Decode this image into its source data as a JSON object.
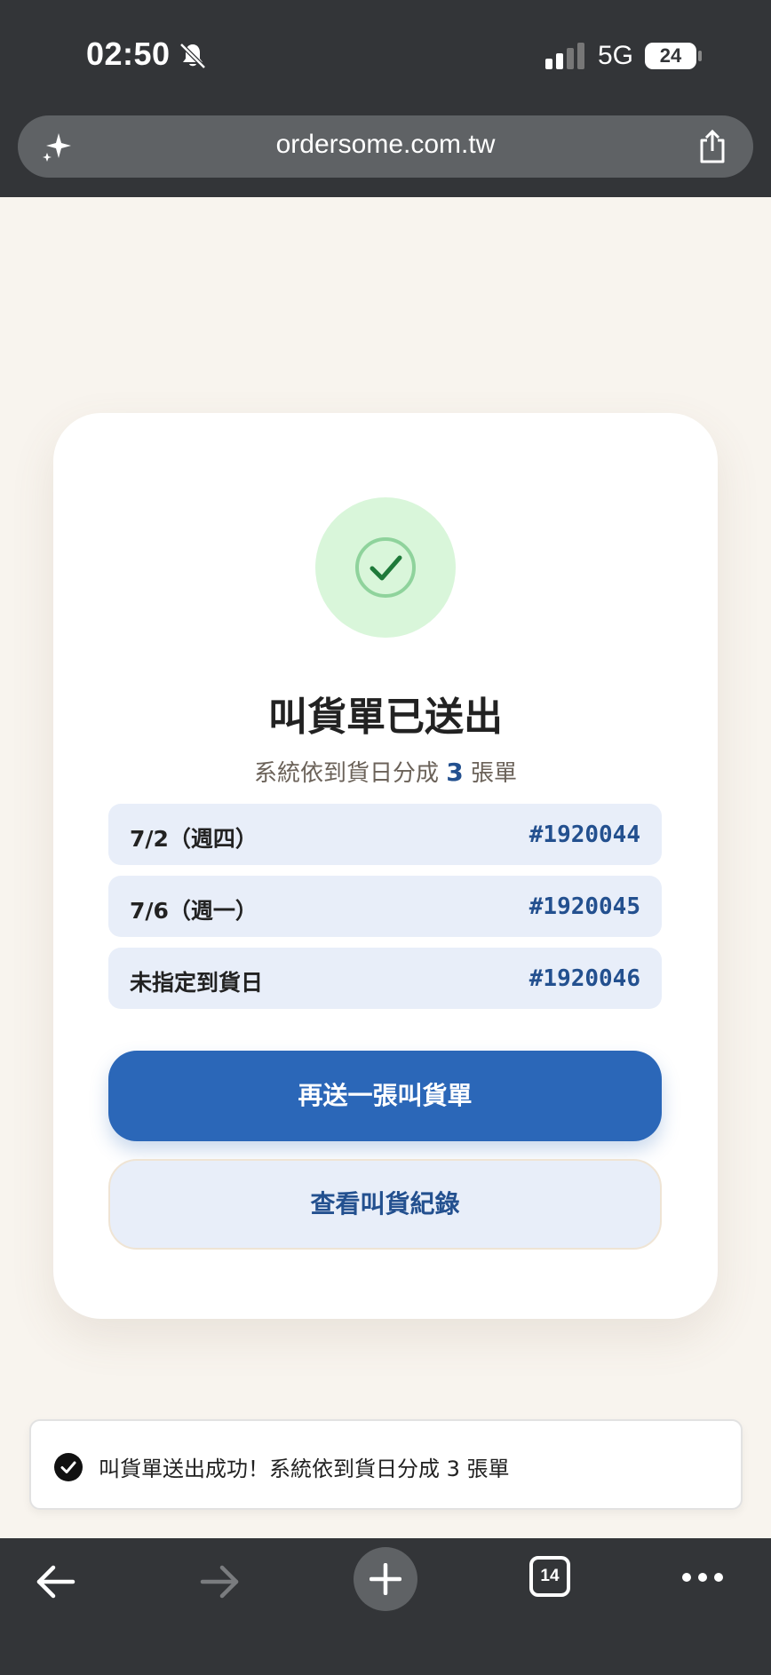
{
  "status_bar": {
    "time": "02:50",
    "network": "5G",
    "battery": "24"
  },
  "browser": {
    "url": "ordersome.com.tw",
    "tab_count": "14"
  },
  "card": {
    "title": "叫貨單已送出",
    "subtitle_prefix": "系統依到貨日分成 ",
    "subtitle_count": "3",
    "subtitle_suffix": " 張單",
    "orders": [
      {
        "date": "7/2（週四）",
        "number": "#1920044"
      },
      {
        "date": "7/6（週一）",
        "number": "#1920045"
      },
      {
        "date": "未指定到貨日",
        "number": "#1920046"
      }
    ],
    "primary_button": "再送一張叫貨單",
    "secondary_button": "查看叫貨紀錄"
  },
  "toast": {
    "message": "叫貨單送出成功！系統依到貨日分成 3 張單"
  },
  "colors": {
    "primary": "#2b67b8",
    "accent_text": "#23508f",
    "success_bg": "#d9f6da",
    "success_check": "#1f7a3a",
    "page_bg": "#f8f4ee"
  },
  "icons": [
    "bell-muted-icon",
    "signal-icon",
    "battery-icon",
    "sparkle-icon",
    "share-icon",
    "check-circle-icon",
    "toast-check-icon",
    "back-arrow-icon",
    "forward-arrow-icon",
    "plus-icon",
    "tabs-icon",
    "more-icon"
  ]
}
